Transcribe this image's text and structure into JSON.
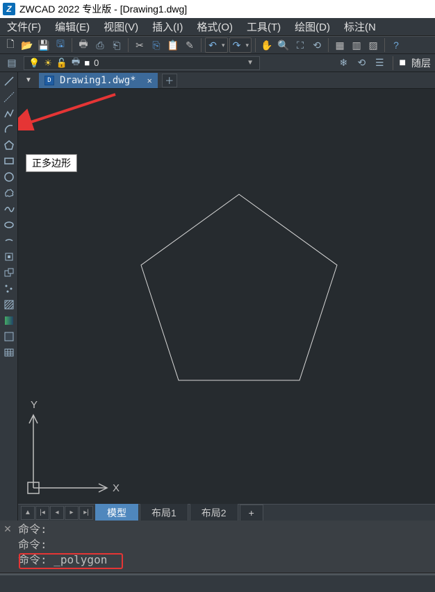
{
  "title": "ZWCAD 2022 专业版 - [Drawing1.dwg]",
  "menu": {
    "file": "文件(F)",
    "edit": "编辑(E)",
    "view": "视图(V)",
    "insert": "插入(I)",
    "format": "格式(O)",
    "tools": "工具(T)",
    "draw": "绘图(D)",
    "annotate": "标注(N"
  },
  "layer": {
    "current": "0",
    "bylayer_label": "随层"
  },
  "doc_tab": {
    "name": "Drawing1.dwg*"
  },
  "tooltip": {
    "polygon": "正多边形"
  },
  "model_tabs": {
    "model": "模型",
    "layout1": "布局1",
    "layout2": "布局2",
    "plus": "+"
  },
  "axis": {
    "x": "X",
    "y": "Y"
  },
  "command": {
    "line1": "命令:",
    "line2": "命令:",
    "line3": "命令: _polygon"
  },
  "icons": {
    "new": "🗋",
    "open": "📂",
    "save": "💾",
    "saveall": "🖫",
    "print": "🖶",
    "cut": "✂",
    "copy": "⎘",
    "paste": "📋",
    "match": "✎",
    "undo": "↶",
    "redo": "↷",
    "pan": "✋",
    "zoom": "🔍",
    "layers": "▤",
    "bulb": "💡",
    "sun": "☀",
    "lock": "🔓",
    "print2": "🖶",
    "square": "■",
    "grid1": "▦",
    "grid2": "▥",
    "grid3": "▨"
  }
}
